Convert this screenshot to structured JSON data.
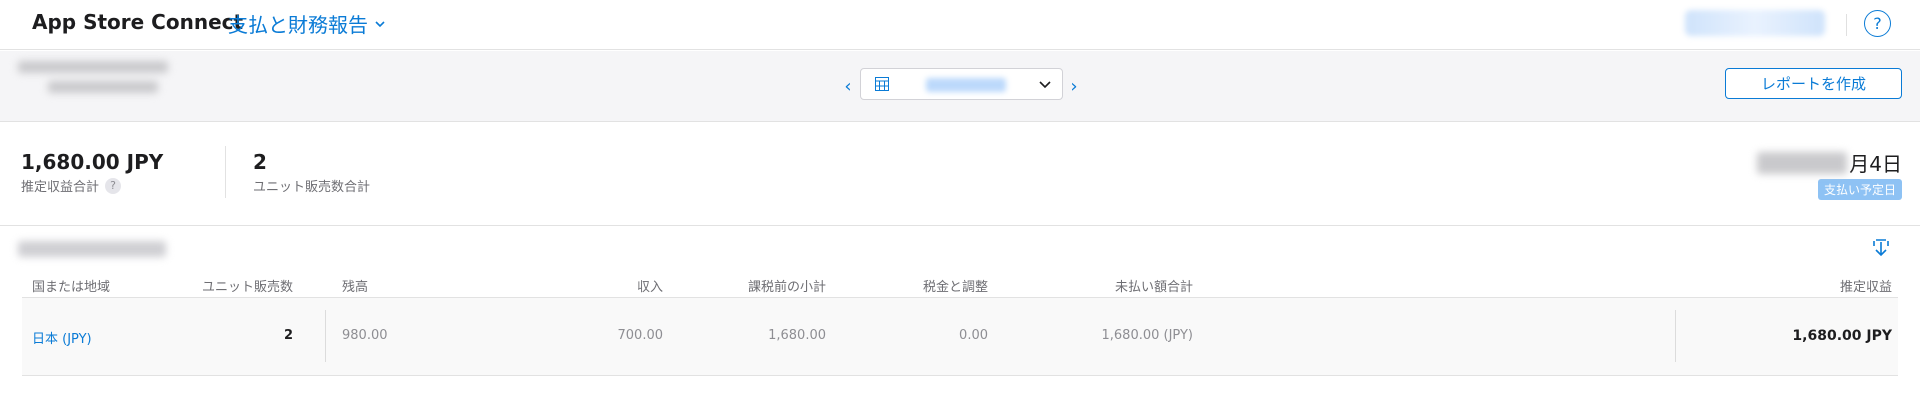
{
  "header": {
    "brand": "App Store Connect",
    "section": "支払と財務報告",
    "help_symbol": "?"
  },
  "toolbar": {
    "prev_symbol": "‹",
    "next_symbol": "›",
    "create_report_label": "レポートを作成"
  },
  "summary": {
    "estimated_revenue_value": "1,680.00 JPY",
    "estimated_revenue_label": "推定収益合計",
    "units_value": "2",
    "units_label": "ユニット販売数合計",
    "payment_date_suffix": "月4日",
    "payment_date_badge": "支払い予定日",
    "help_symbol": "?"
  },
  "table": {
    "columns": [
      "国または地域",
      "ユニット販売数",
      "残高",
      "収入",
      "課税前の小計",
      "税金と調整",
      "未払い額合計",
      "推定収益"
    ],
    "rows": [
      {
        "region": "日本 (JPY)",
        "units": "2",
        "balance": "980.00",
        "income": "700.00",
        "pretax_subtotal": "1,680.00",
        "tax_adjustments": "0.00",
        "unpaid_total": "1,680.00 (JPY)",
        "estimated_revenue": "1,680.00 JPY"
      }
    ]
  },
  "colors": {
    "accent": "#0a7bd6",
    "toolbar_bg": "#f5f5f7",
    "badge_bg": "#8ec2f4"
  }
}
